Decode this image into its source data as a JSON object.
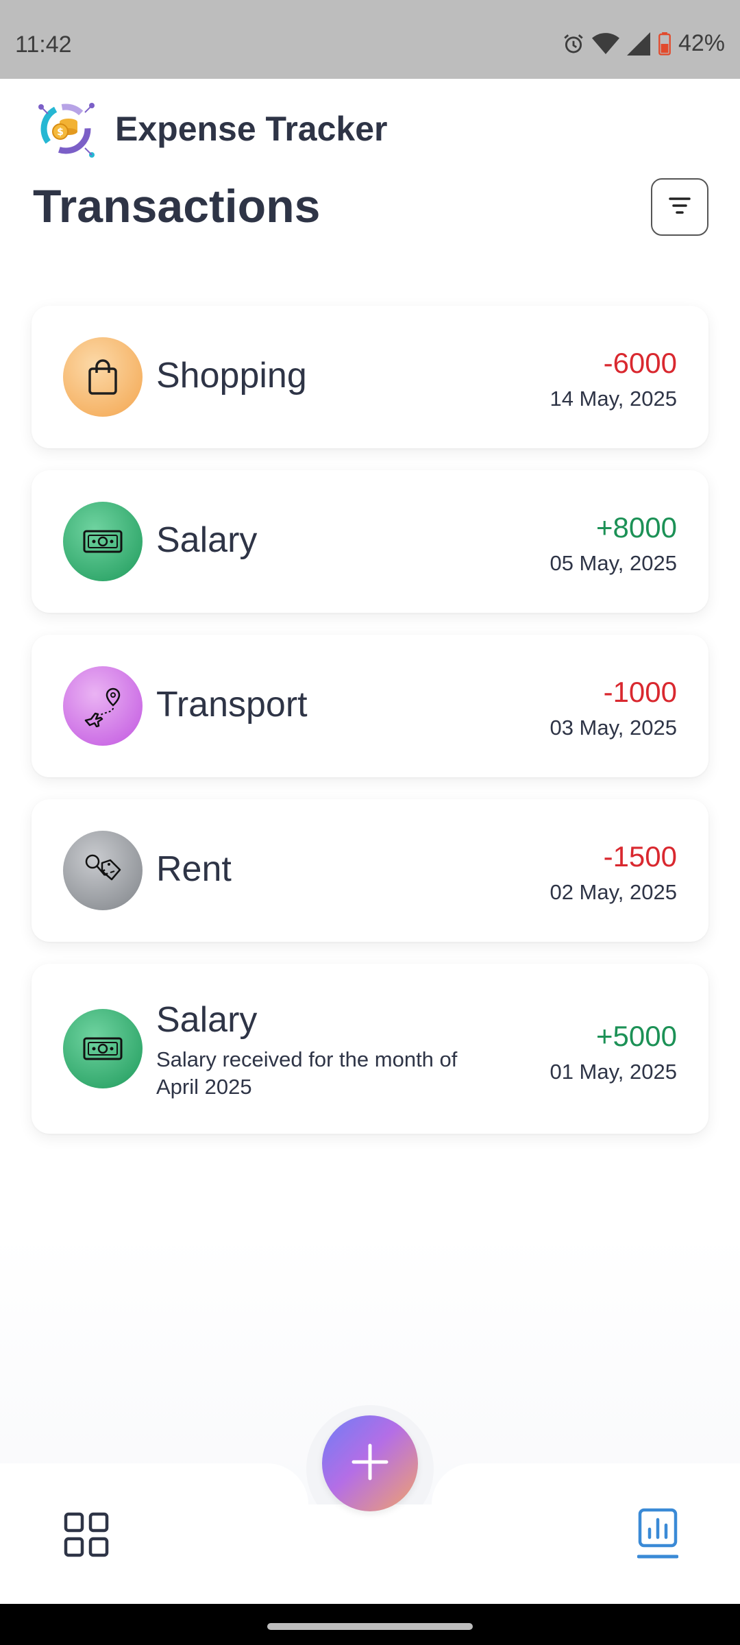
{
  "status_bar": {
    "time": "11:42",
    "battery": "42%"
  },
  "app": {
    "name": "Expense Tracker"
  },
  "page": {
    "title": "Transactions"
  },
  "icons": {
    "alarm": "alarm-icon",
    "wifi": "wifi-icon",
    "signal": "signal-icon",
    "battery": "battery-icon",
    "logo": "expense-tracker-logo",
    "filter": "filter-icon",
    "shopping": "shopping-bag-icon",
    "salary": "money-icon",
    "transport": "airplane-route-icon",
    "rent": "key-tag-icon",
    "add": "plus-icon",
    "dashboard": "grid-icon",
    "stats": "chart-icon"
  },
  "colors": {
    "negative": "#d9282f",
    "positive": "#1c9156",
    "active_nav": "#3a8ad6"
  },
  "transactions": [
    {
      "name": "Shopping",
      "amount": "-6000",
      "date": "14 May, 2025",
      "note": ""
    },
    {
      "name": "Salary",
      "amount": "+8000",
      "date": "05 May, 2025",
      "note": ""
    },
    {
      "name": "Transport",
      "amount": "-1000",
      "date": "03 May, 2025",
      "note": ""
    },
    {
      "name": "Rent",
      "amount": "-1500",
      "date": "02 May, 2025",
      "note": ""
    },
    {
      "name": "Salary",
      "amount": "+5000",
      "date": "01 May, 2025",
      "note": "Salary received for the month of April 2025"
    }
  ],
  "bottom_nav": {
    "active_tab": "stats"
  }
}
